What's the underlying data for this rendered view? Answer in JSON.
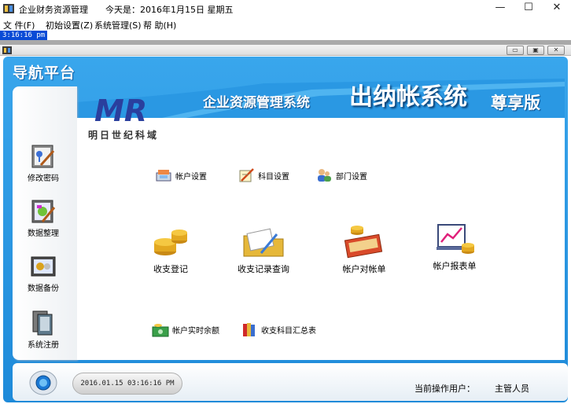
{
  "window": {
    "title": "企业财务资源管理",
    "today_text": "今天是：2016年1月15日 星期五",
    "minimize": "—",
    "maximize": "☐",
    "close": "✕"
  },
  "menu": [
    {
      "label": "文  件(F)"
    },
    {
      "label": "初始设置(Z)"
    },
    {
      "label": "系统管理(S)"
    },
    {
      "label": "帮 助(H)"
    }
  ],
  "clock": "3:16:16 pm",
  "child_buttons": [
    "▭",
    "▣",
    "✕"
  ],
  "header": {
    "nav_title": "导航平台",
    "system_name": "企业资源管理系统",
    "cashier_title": "出纳帐系统",
    "edition": "尊享版"
  },
  "logo": {
    "mark": "MR",
    "subtitle": "明日世纪科域"
  },
  "sidebar": {
    "items": [
      {
        "label": "修改密码",
        "icon": "password-icon"
      },
      {
        "label": "数据整理",
        "icon": "data-organize-icon"
      },
      {
        "label": "数据备份",
        "icon": "backup-icon"
      },
      {
        "label": "系统注册",
        "icon": "register-icon"
      }
    ]
  },
  "settings": [
    {
      "label": "帐户设置",
      "icon": "account-settings-icon"
    },
    {
      "label": "科目设置",
      "icon": "subject-settings-icon"
    },
    {
      "label": "部门设置",
      "icon": "department-settings-icon"
    }
  ],
  "actions": [
    {
      "label": "收支登记",
      "icon": "coins-icon"
    },
    {
      "label": "收支记录查询",
      "icon": "folder-search-icon"
    },
    {
      "label": "帐户对帐单",
      "icon": "statement-icon"
    },
    {
      "label": "帐户报表单",
      "icon": "report-chart-icon"
    }
  ],
  "bottom_links": [
    {
      "label": "帐户实时余额",
      "icon": "cash-balance-icon"
    },
    {
      "label": "收支科目汇总表",
      "icon": "books-summary-icon"
    }
  ],
  "footer": {
    "datetime": "2016.01.15 03:16:16 PM",
    "operator_label": "当前操作用户：",
    "operator": "主管人员"
  }
}
